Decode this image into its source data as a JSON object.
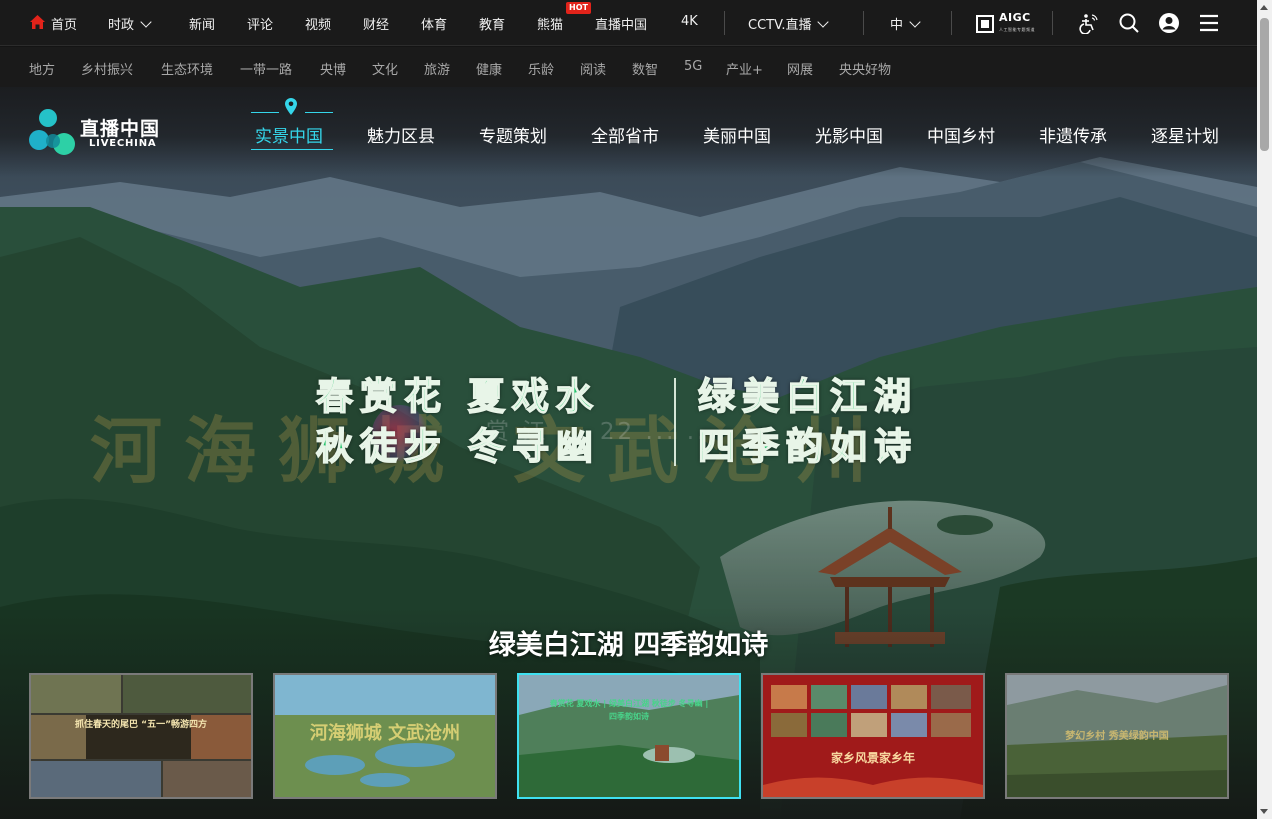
{
  "top_nav": {
    "home": "首页",
    "politics": "时政",
    "news": "新闻",
    "comment": "评论",
    "video": "视频",
    "finance": "财经",
    "sports": "体育",
    "education": "教育",
    "panda": "熊猫",
    "panda_badge": "HOT",
    "live_china": "直播中国",
    "k4": "4K",
    "cctv_live": "CCTV.直播",
    "language": "中",
    "aigc": "AIGC",
    "aigc_sub": "人工智能专题频道",
    "icons": [
      "accessibility-icon",
      "search-icon",
      "user-icon",
      "menu-icon"
    ]
  },
  "sub_nav": [
    "地方",
    "乡村振兴",
    "生态环境",
    "一带一路",
    "央博",
    "文化",
    "旅游",
    "健康",
    "乐龄",
    "阅读",
    "数智",
    "5G",
    "产业+",
    "网展",
    "央央好物"
  ],
  "channel": {
    "logo_name": "直播中国",
    "logo_sub": "LIVECHINA",
    "tabs": [
      "实景中国",
      "魅力区县",
      "专题策划",
      "全部省市",
      "美丽中国",
      "光影中国",
      "中国乡村",
      "非遗传承",
      "逐星计划"
    ],
    "active_tab": 0
  },
  "hero": {
    "banner_left": [
      "春赏花 夏戏水",
      "秋徒步 冬寻幽"
    ],
    "banner_right": [
      "绿美白江湖",
      "四季韵如诗"
    ],
    "watermark": "河海狮城 文武沧州",
    "watermark_url": "赏 江 ··· 22 ... ..",
    "title": "绿美白江湖 四季韵如诗",
    "thumbnails": [
      {
        "caption": "抓住春天的尾巴 “五一”畅游四方",
        "active": false
      },
      {
        "caption": "河海狮城 文武沧州",
        "active": false
      },
      {
        "caption": "春赏花 夏戏水 | 绿美白江湖 秋徒步 冬寻幽 | 四季韵如诗",
        "active": true
      },
      {
        "caption": "家乡风景家乡年",
        "active": false
      },
      {
        "caption": "梦幻乡村 秀美绿韵中国",
        "active": false
      }
    ]
  },
  "colors": {
    "accent": "#35d6ea",
    "hot": "#e2231a",
    "banner_green": "#23c26b"
  }
}
